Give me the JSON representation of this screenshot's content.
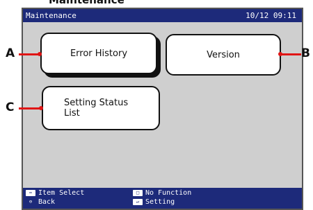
{
  "caption": "Maintenance",
  "header": {
    "title": "Maintenance",
    "clock": "10/12 09:11"
  },
  "buttons": {
    "error_history": "Error History",
    "version": "Version",
    "setting_status_line1": "Setting Status",
    "setting_status_line2": "List"
  },
  "callouts": {
    "a": "A",
    "b": "B",
    "c": "C"
  },
  "footer": {
    "item_select": "Item Select",
    "back": "Back",
    "no_function": "No Function",
    "setting": "Setting"
  },
  "icons": {
    "item_select": "left-right-arrow-icon",
    "back": "back-icon",
    "no_function": "rectangle-button-icon",
    "setting": "enter-icon"
  },
  "colors": {
    "title_bar": "#1d2a7a",
    "screen_bg": "#cfcfcf",
    "callout": "#e01515"
  }
}
